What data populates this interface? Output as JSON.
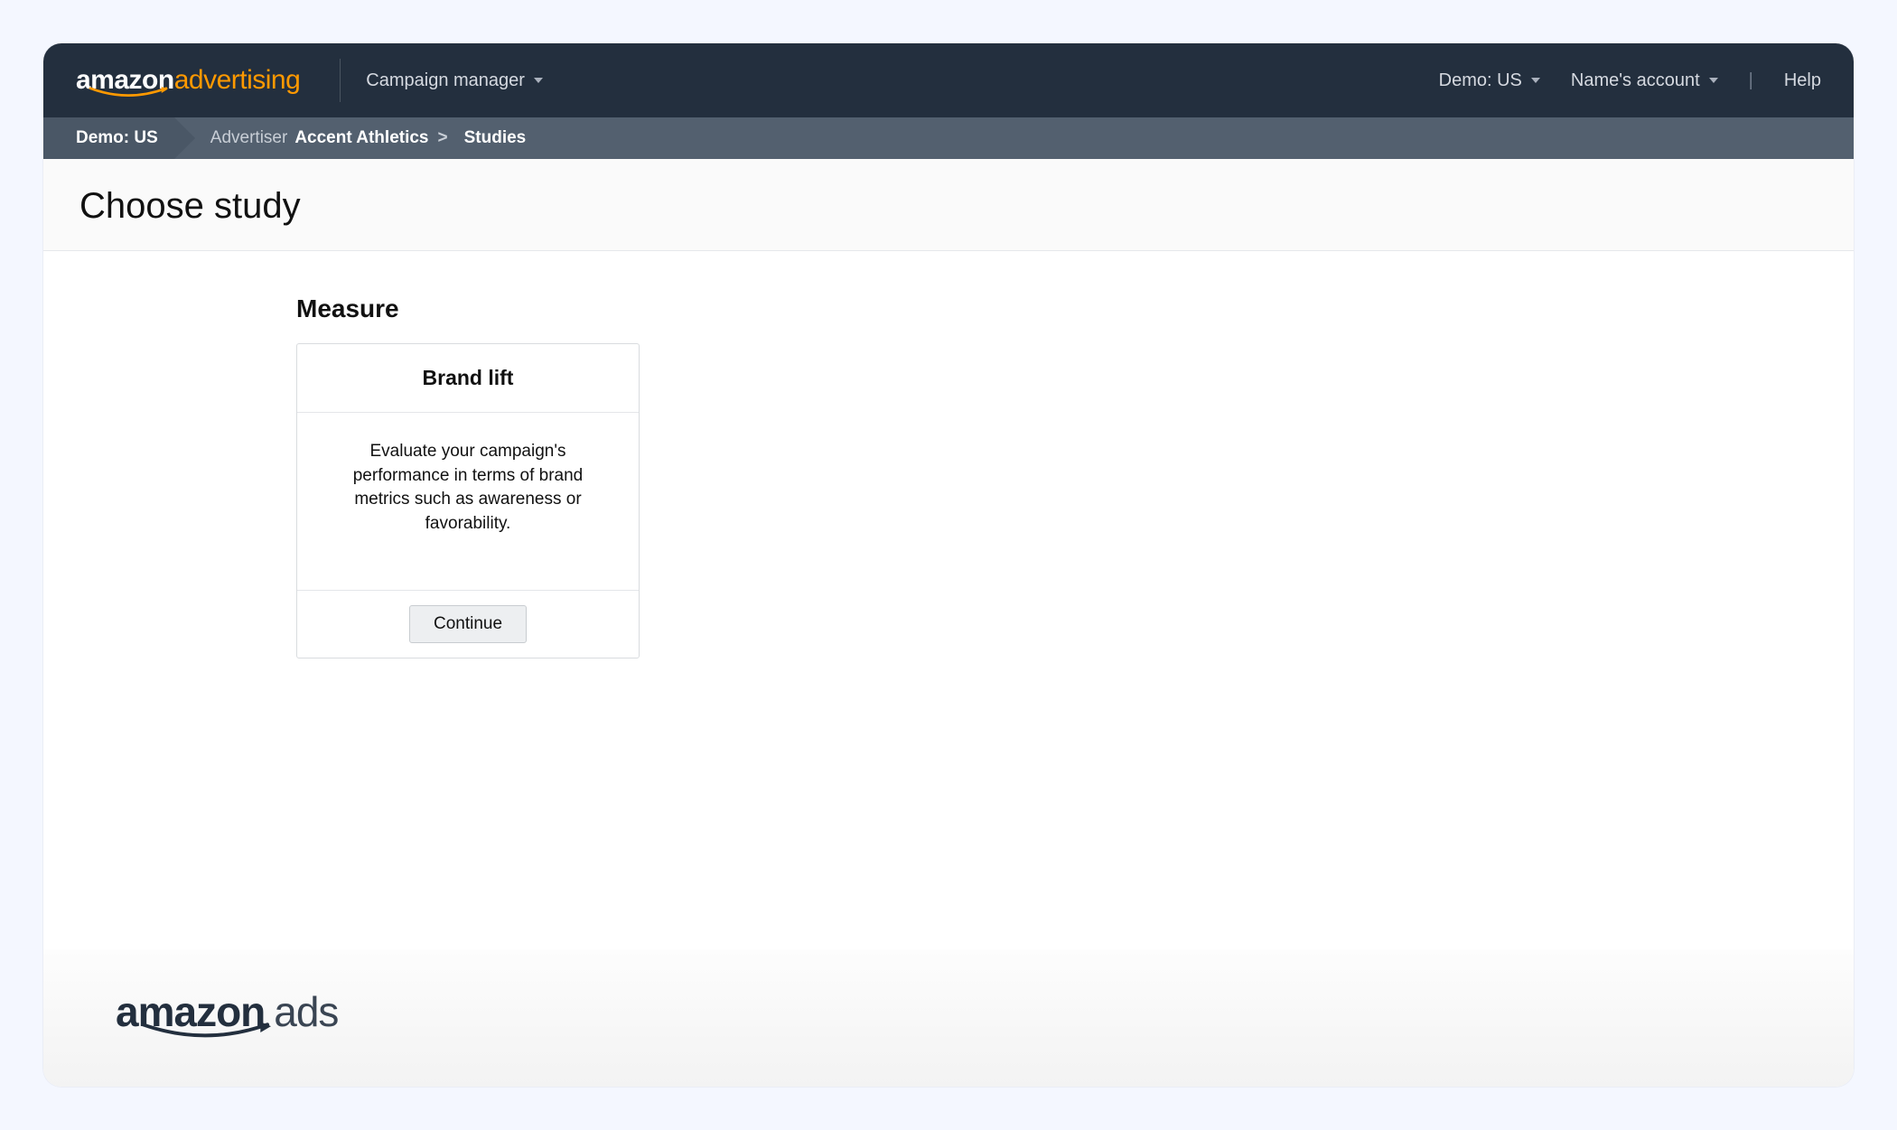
{
  "header": {
    "logo_primary": "amazon",
    "logo_secondary": "advertising",
    "campaign_manager": "Campaign manager",
    "demo": "Demo: US",
    "account": "Name's account",
    "help": "Help"
  },
  "breadcrumb": {
    "demo": "Demo: US",
    "advertiser_label": "Advertiser",
    "advertiser_name": "Accent Athletics",
    "studies": "Studies"
  },
  "page": {
    "title": "Choose study"
  },
  "section": {
    "title": "Measure"
  },
  "card": {
    "title": "Brand lift",
    "description": "Evaluate your campaign's performance in terms of brand metrics such as awareness or favorability.",
    "cta": "Continue"
  },
  "footer": {
    "logo_primary": "amazon",
    "logo_secondary": "ads"
  }
}
